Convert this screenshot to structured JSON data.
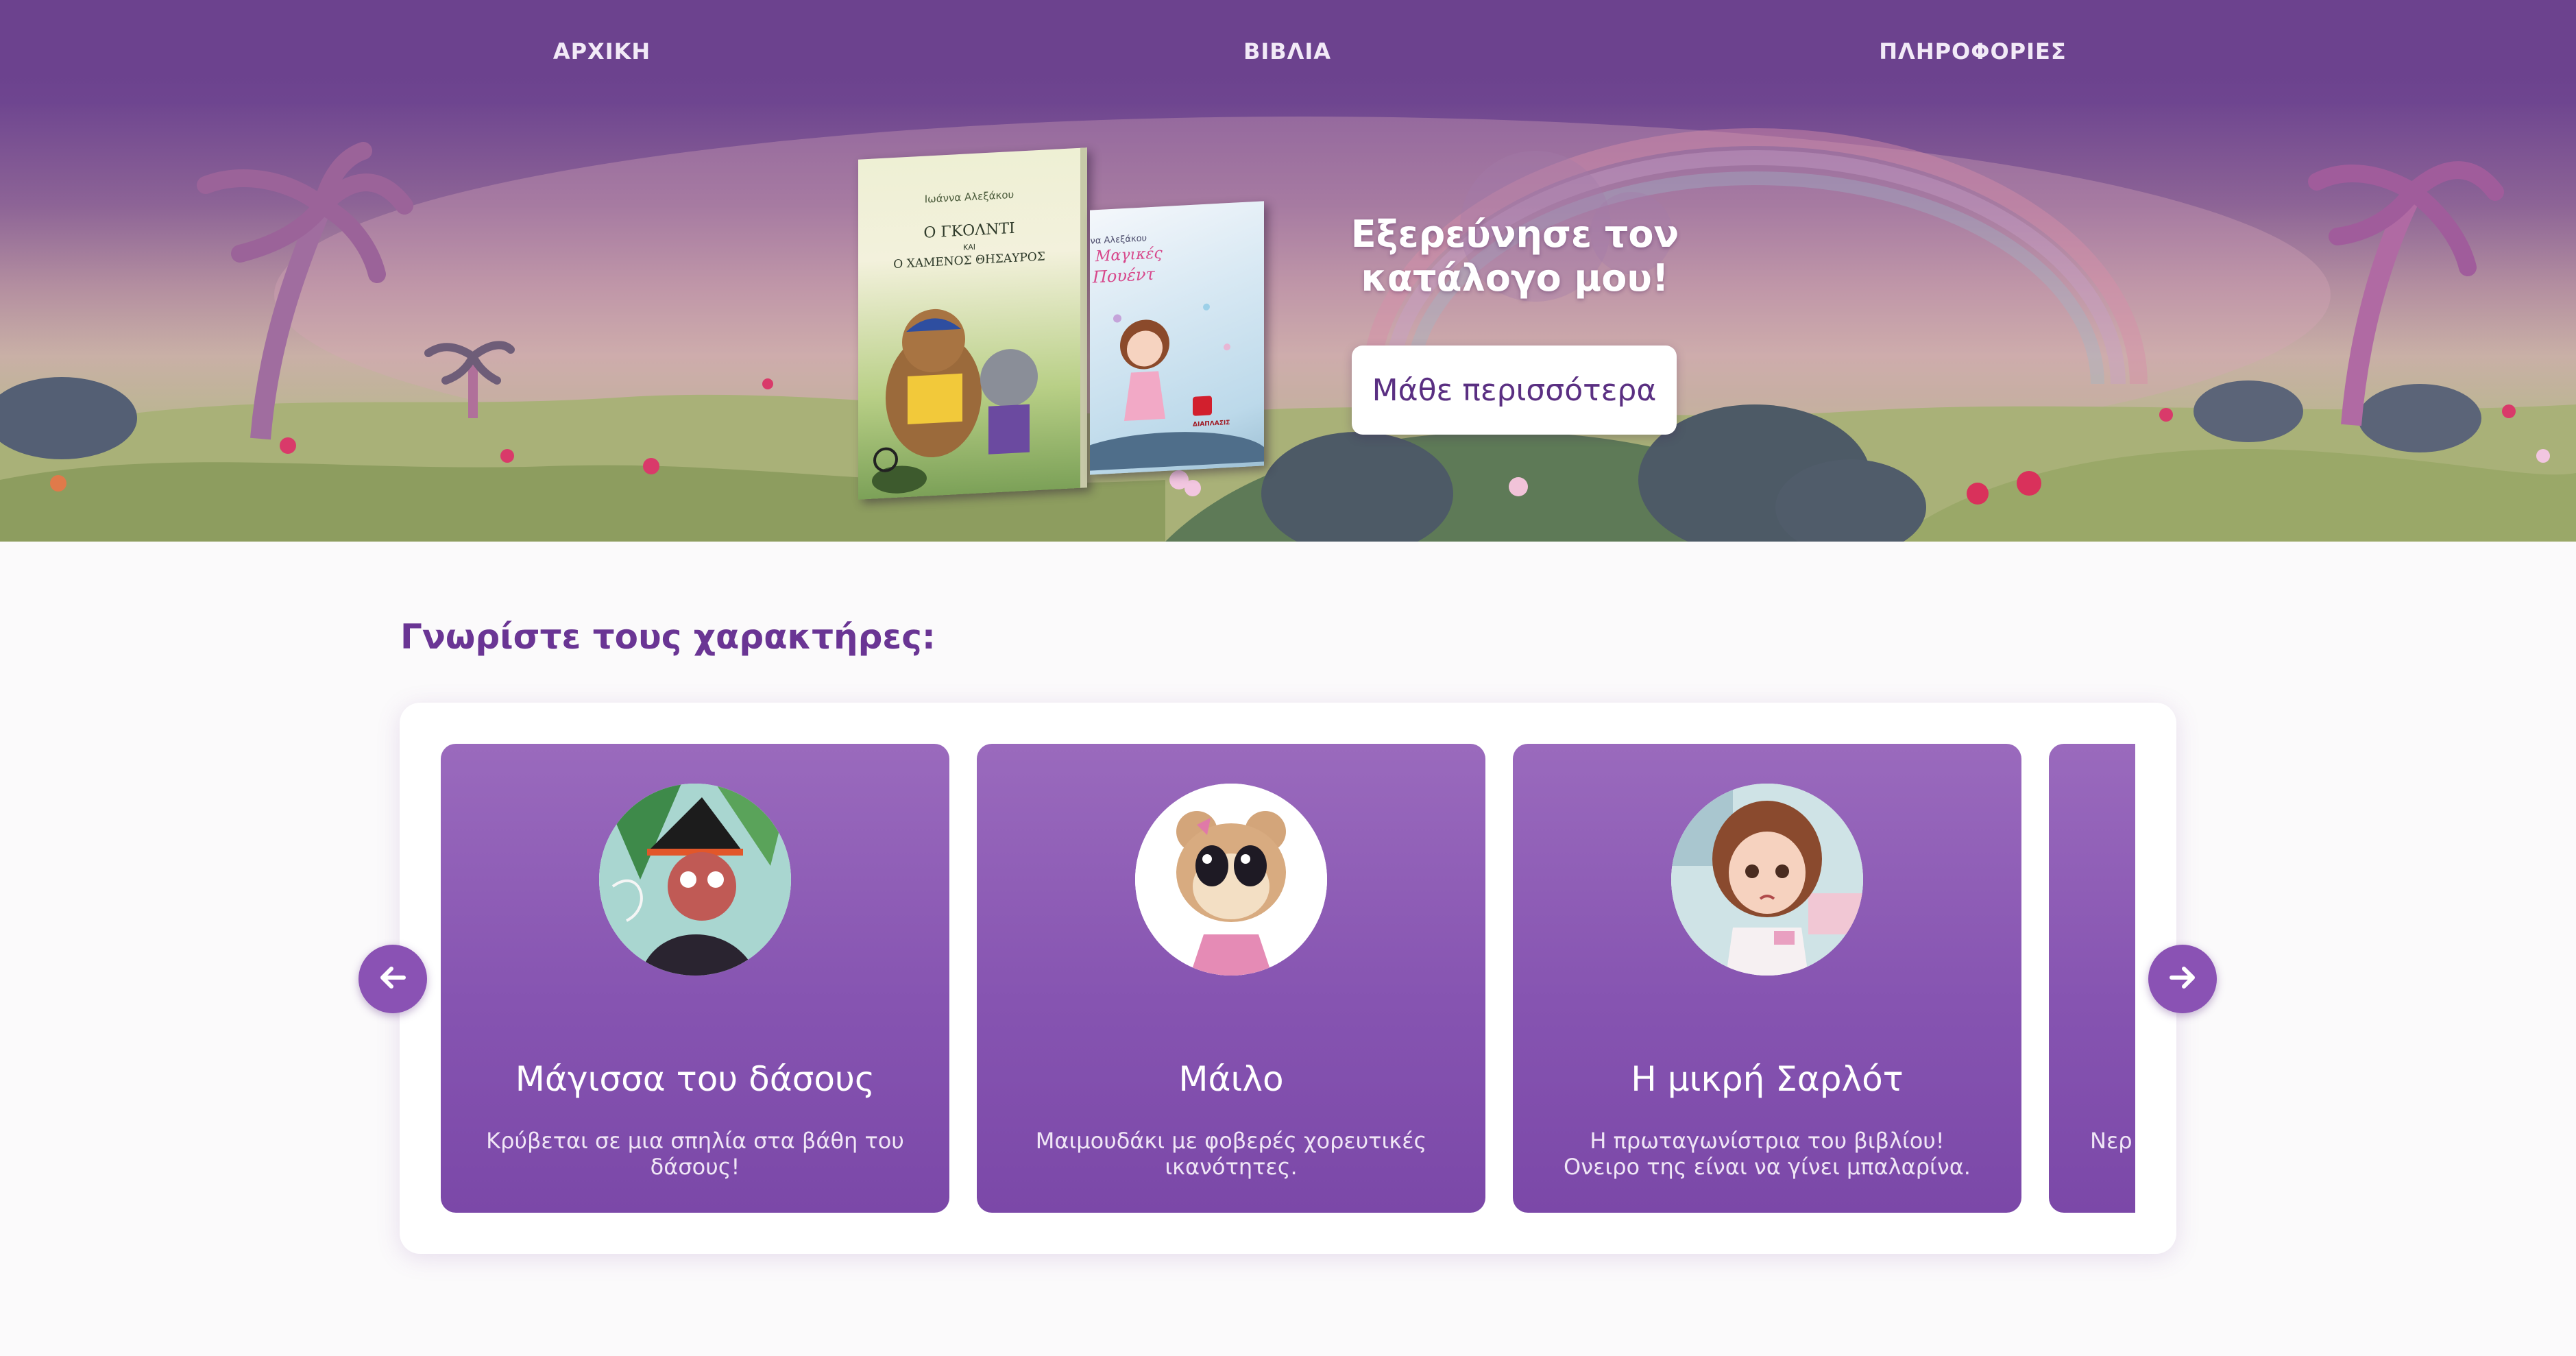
{
  "nav": {
    "items": [
      {
        "label": "ΑΡΧΙΚΗ"
      },
      {
        "label": "ΒΙΒΛΙΑ"
      },
      {
        "label": "ΠΛΗΡΟΦΟΡΙΕΣ"
      }
    ]
  },
  "hero": {
    "title_line1": "Εξερεύνησε τον",
    "title_line2": "κατάλογο μου!",
    "button_label": "Μάθε περισσότερα",
    "book1": {
      "author": "Ιωάννα Αλεξάκου",
      "title_line1": "Ο ΓΚΟΛΝΤΙ",
      "title_line2": "ΚΑΙ",
      "title_line3": "Ο ΧΑΜΕΝΟΣ ΘΗΣΑΥΡΟΣ"
    },
    "book2": {
      "author": "Ιωάννα Αλεξάκου",
      "title_line1": "Μαγικές",
      "title_line2": "Πουέντ",
      "publisher": "ΔΙΑΠΛΑΣΙΣ"
    }
  },
  "characters": {
    "heading": "Γνωρίστε τους χαρακτήρες:",
    "items": [
      {
        "name": "Μάγισσα του δάσους",
        "description": "Κρύβεται σε μια σπηλία στα βάθη του δάσους!"
      },
      {
        "name": "Μάιλο",
        "description": "Μαιμουδάκι με φοβερές χορευτικές ικανότητες."
      },
      {
        "name": "Η μικρή Σαρλότ",
        "description": "Η πρωταγωνίστρια του βιβλίου! Ονειρο της είναι να γίνει μπαλαρίνα."
      },
      {
        "name": "",
        "description": "Νερ"
      }
    ]
  },
  "icons": {
    "prev": "arrow-left-icon",
    "next": "arrow-right-icon"
  },
  "colors": {
    "brand_purple": "#6a3594",
    "card_purple": "#8654b1",
    "nav_purple": "#6c428e"
  }
}
